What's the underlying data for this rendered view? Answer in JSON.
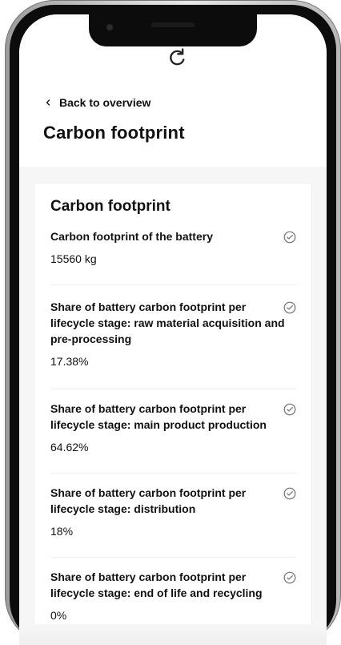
{
  "colors": {
    "background": "#f6f6f6",
    "card": "#ffffff",
    "text": "#111111",
    "icon_muted": "#7d7d7d"
  },
  "nav": {
    "back_label": "Back to overview",
    "back_icon": "chevron-left-icon",
    "brand_icon": "refresh-logo-icon"
  },
  "page": {
    "title": "Carbon footprint"
  },
  "card": {
    "title": "Carbon footprint",
    "status_icon": "check-circle-icon",
    "items": [
      {
        "label": "Carbon footprint of the battery",
        "value": "15560 kg"
      },
      {
        "label": "Share of battery carbon footprint per lifecycle stage: raw material acquisition and pre-processing",
        "value": "17.38%"
      },
      {
        "label": "Share of battery carbon footprint per lifecycle stage: main product production",
        "value": "64.62%"
      },
      {
        "label": "Share of battery carbon footprint per lifecycle stage: distribution",
        "value": "18%"
      },
      {
        "label": "Share of battery carbon footprint per lifecycle stage: end of life and recycling",
        "value": "0%"
      }
    ]
  }
}
